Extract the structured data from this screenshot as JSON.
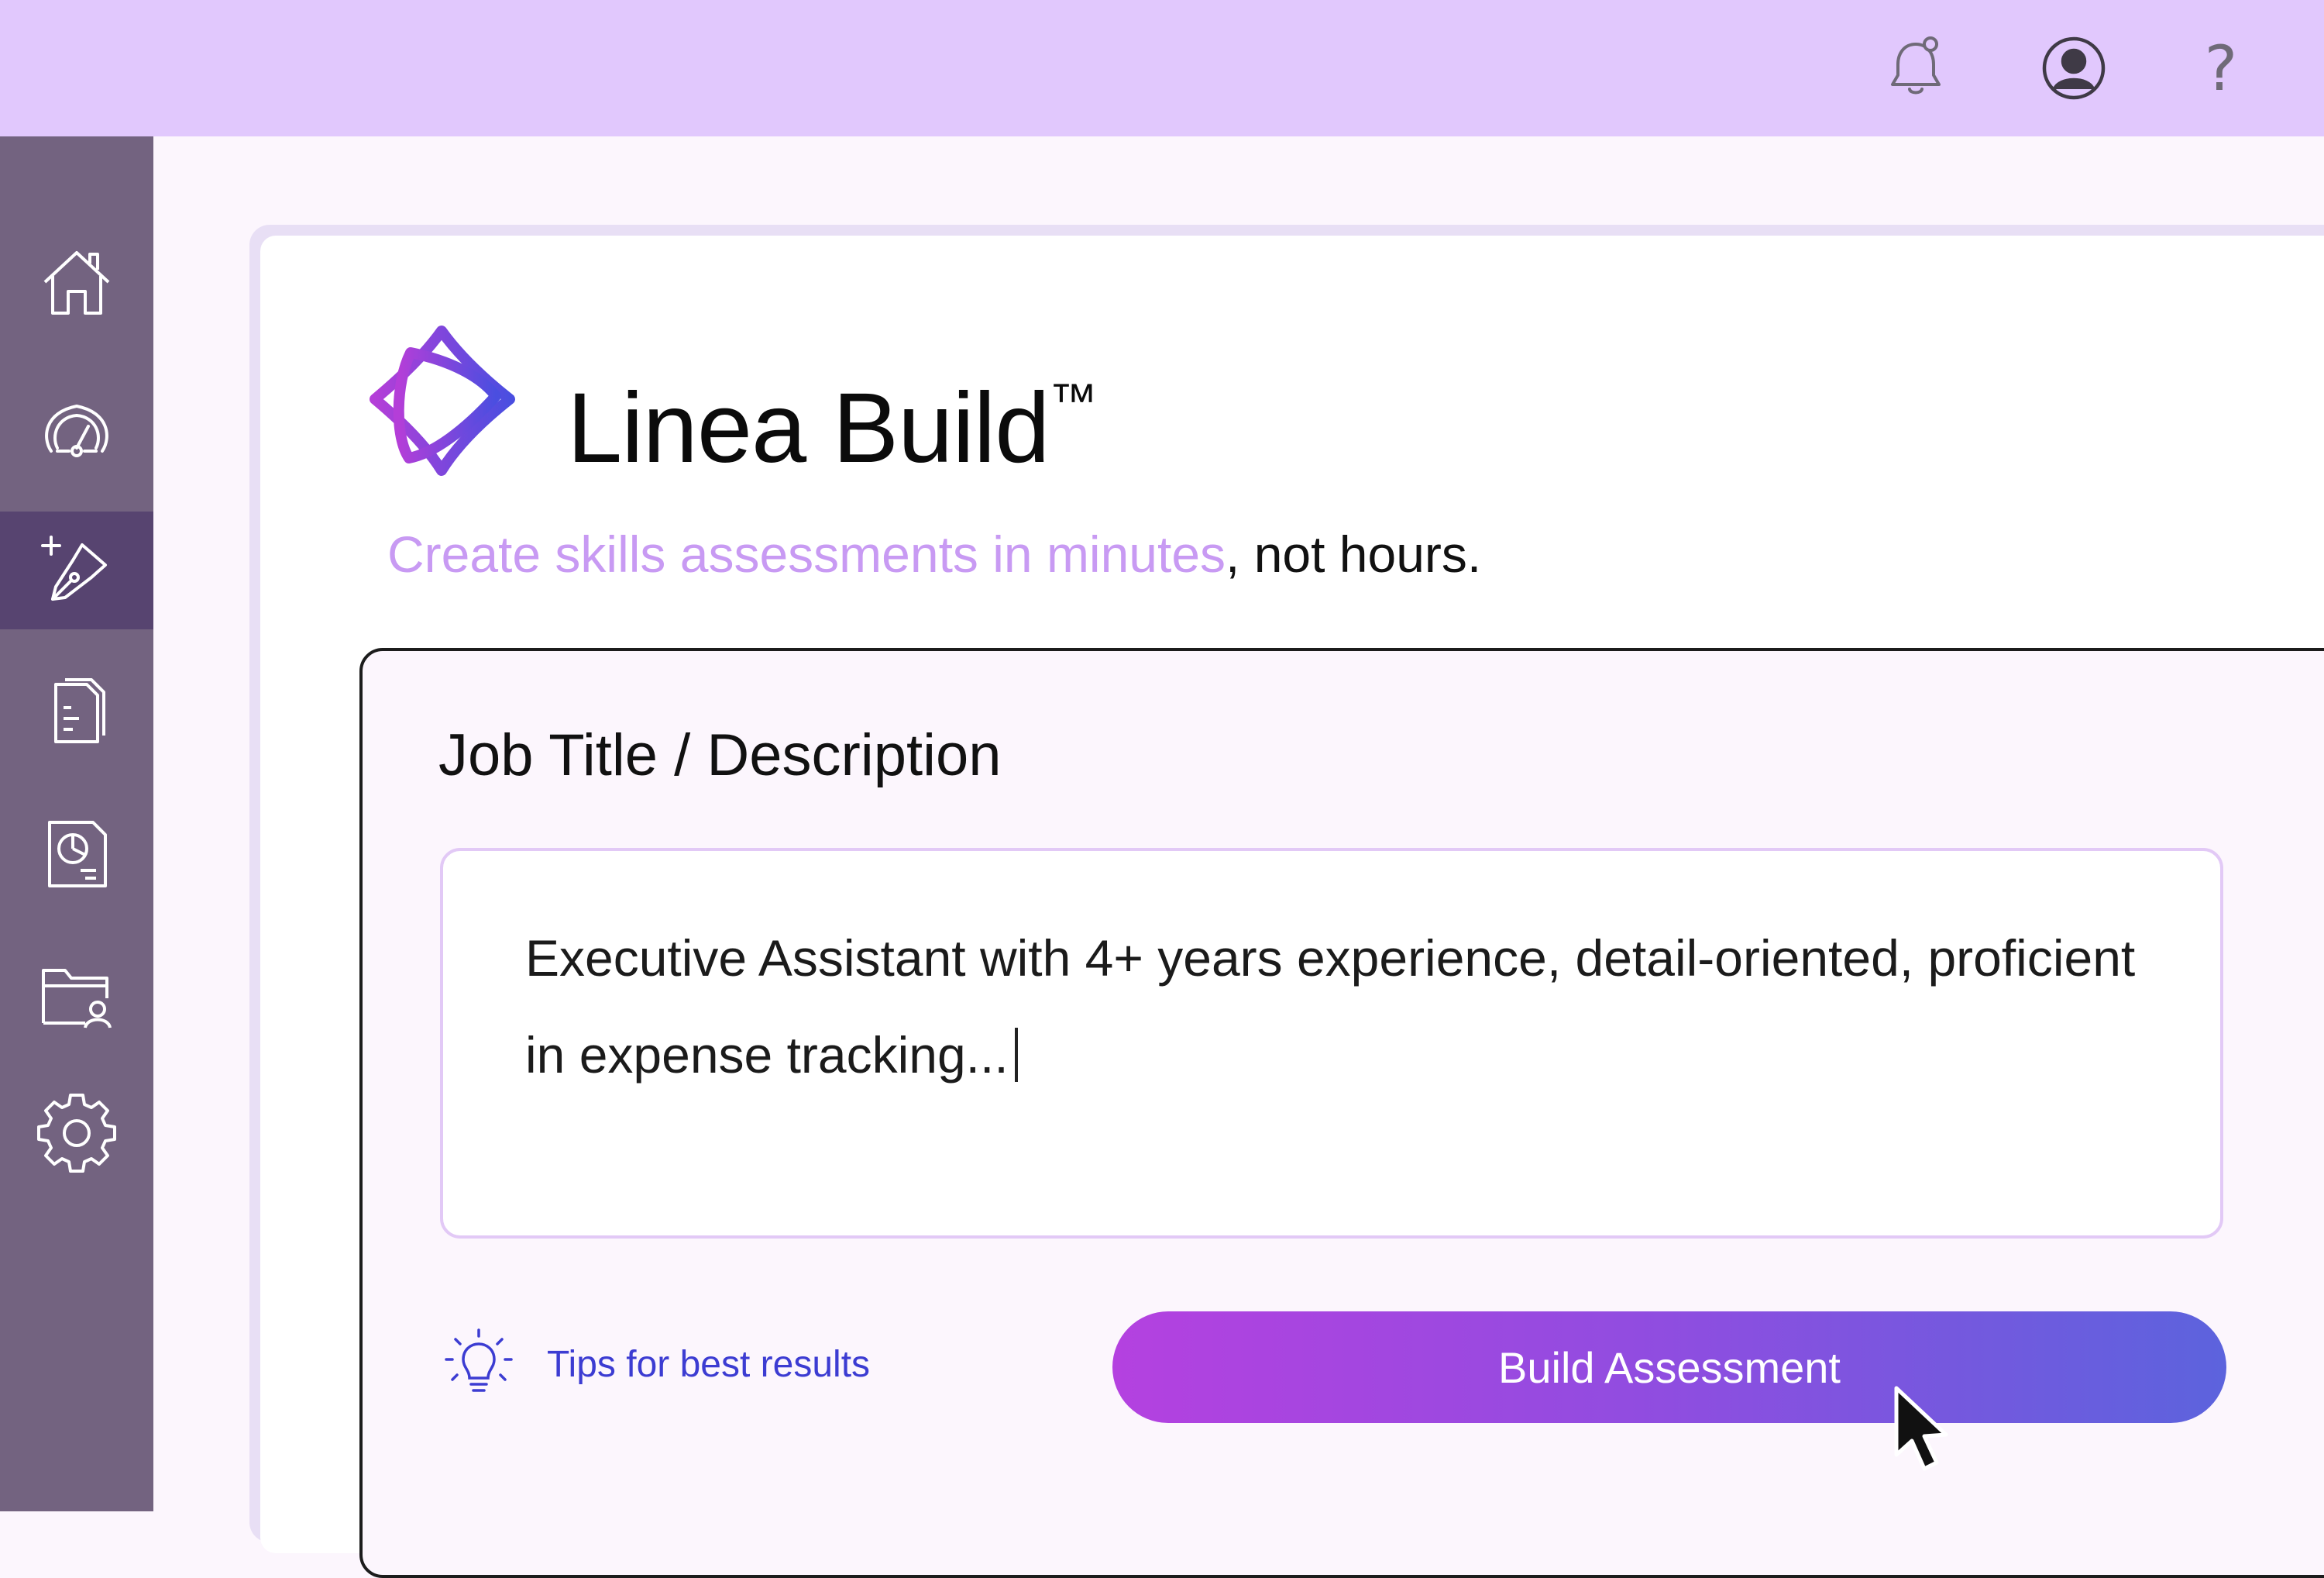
{
  "topbar": {
    "icons": [
      "bell-icon",
      "user-account-icon",
      "help-icon"
    ],
    "help_glyph": "?"
  },
  "sidebar": {
    "items": [
      {
        "icon": "home-icon",
        "active": false
      },
      {
        "icon": "dashboard-gauge-icon",
        "active": false
      },
      {
        "icon": "create-pen-icon",
        "active": true
      },
      {
        "icon": "documents-icon",
        "active": false
      },
      {
        "icon": "reports-icon",
        "active": false
      },
      {
        "icon": "folder-user-icon",
        "active": false
      },
      {
        "icon": "settings-gear-icon",
        "active": false
      }
    ]
  },
  "header": {
    "title": "Linea Build",
    "trademark": "™",
    "tagline_highlight": "Create skills assessments in minutes",
    "tagline_rest": ", not hours."
  },
  "form": {
    "field_label": "Job Title / Description",
    "textarea_value": "Executive Assistant with 4+ years experience, detail-oriented, proficient in expense tracking...",
    "tips_label": "Tips for best results",
    "build_button_label": "Build Assessment"
  },
  "colors": {
    "topbar": "#e1c8fd",
    "sidebar": "#736380",
    "sidebar_active": "#574470",
    "highlight_text": "#c89af3",
    "link_text": "#3c3cd2",
    "button_gradient_start": "#b441e0",
    "button_gradient_end": "#5c63dd"
  }
}
